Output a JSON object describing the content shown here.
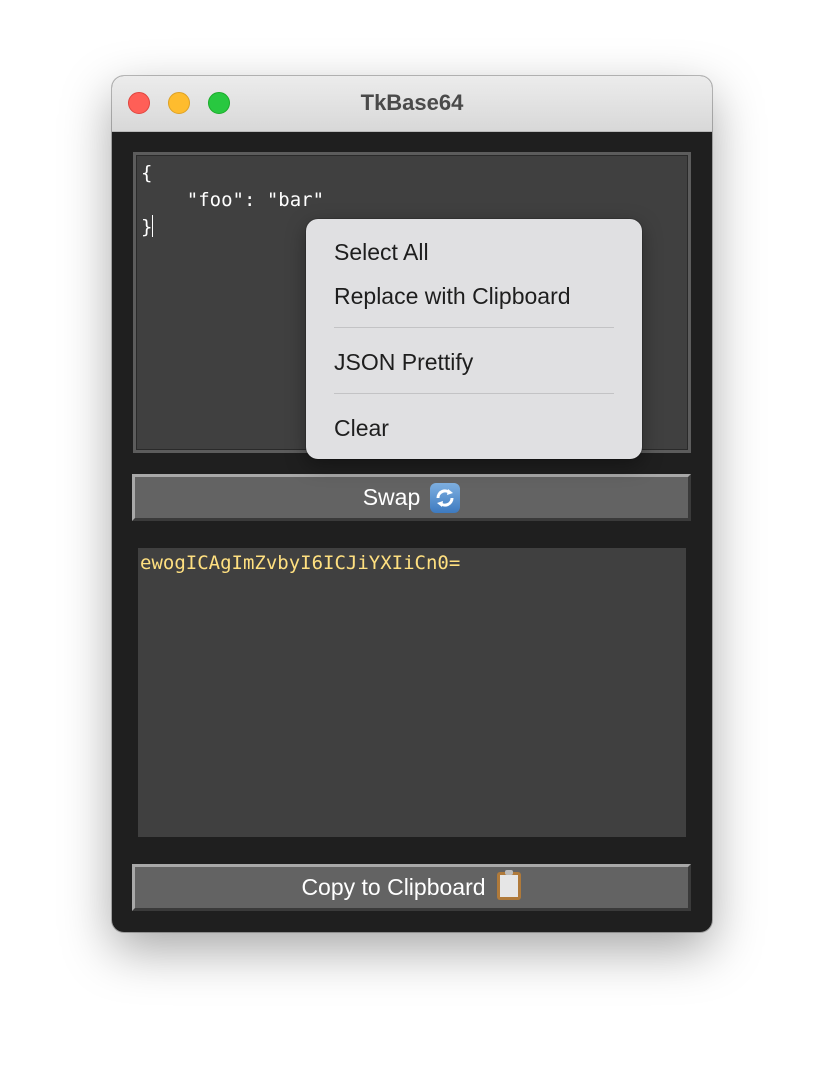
{
  "window": {
    "title": "TkBase64",
    "controls": {
      "close_color": "#ff5f57",
      "minimize_color": "#febc2e",
      "zoom_color": "#28c840"
    }
  },
  "input": {
    "lines": [
      "{",
      "    \"foo\": \"bar\"",
      "}"
    ]
  },
  "context_menu": {
    "items": [
      {
        "label": "Select All"
      },
      {
        "label": "Replace with Clipboard"
      },
      {
        "label": "JSON Prettify"
      },
      {
        "label": "Clear"
      }
    ]
  },
  "swap_button": {
    "label": "Swap",
    "icon": "arrows-counterclockwise-icon"
  },
  "output": {
    "text": "ewogICAgImZvbyI6ICJiYXIiCn0=",
    "color": "#ffe080"
  },
  "copy_button": {
    "label": "Copy to Clipboard",
    "icon": "clipboard-icon"
  }
}
